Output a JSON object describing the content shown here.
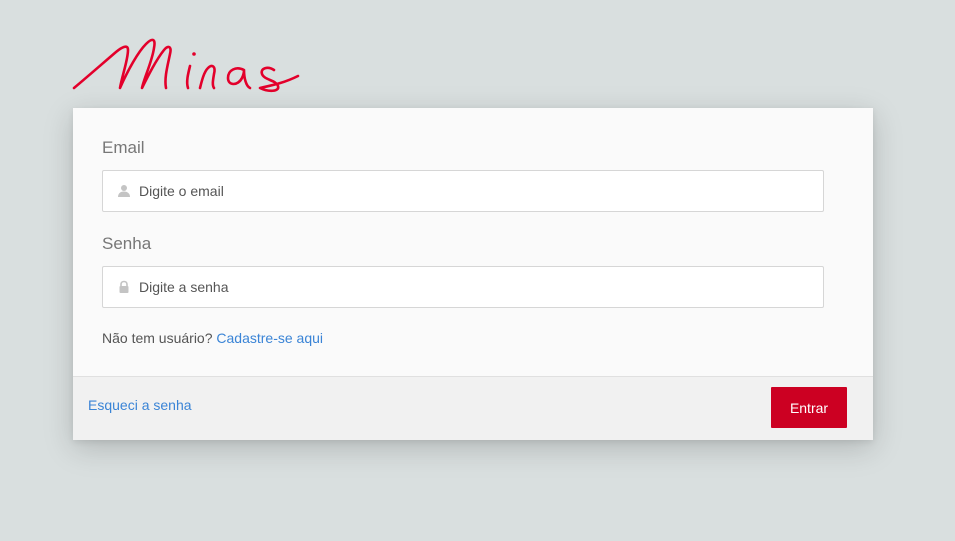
{
  "brand": {
    "logo_text": "Minas",
    "logo_color": "#e3002b"
  },
  "form": {
    "email": {
      "label": "Email",
      "placeholder": "Digite o email",
      "value": "",
      "icon": "user-icon"
    },
    "password": {
      "label": "Senha",
      "placeholder": "Digite a senha",
      "value": "",
      "icon": "lock-icon"
    },
    "register": {
      "prompt": "Não tem usuário?",
      "link_text": "Cadastre-se aqui"
    }
  },
  "footer": {
    "forgot_text": "Esqueci a senha",
    "submit_label": "Entrar"
  },
  "colors": {
    "background": "#d9dfdf",
    "card": "#fafafa",
    "footer": "#f1f1f1",
    "accent": "#cc0022",
    "link": "#3a84d6"
  }
}
